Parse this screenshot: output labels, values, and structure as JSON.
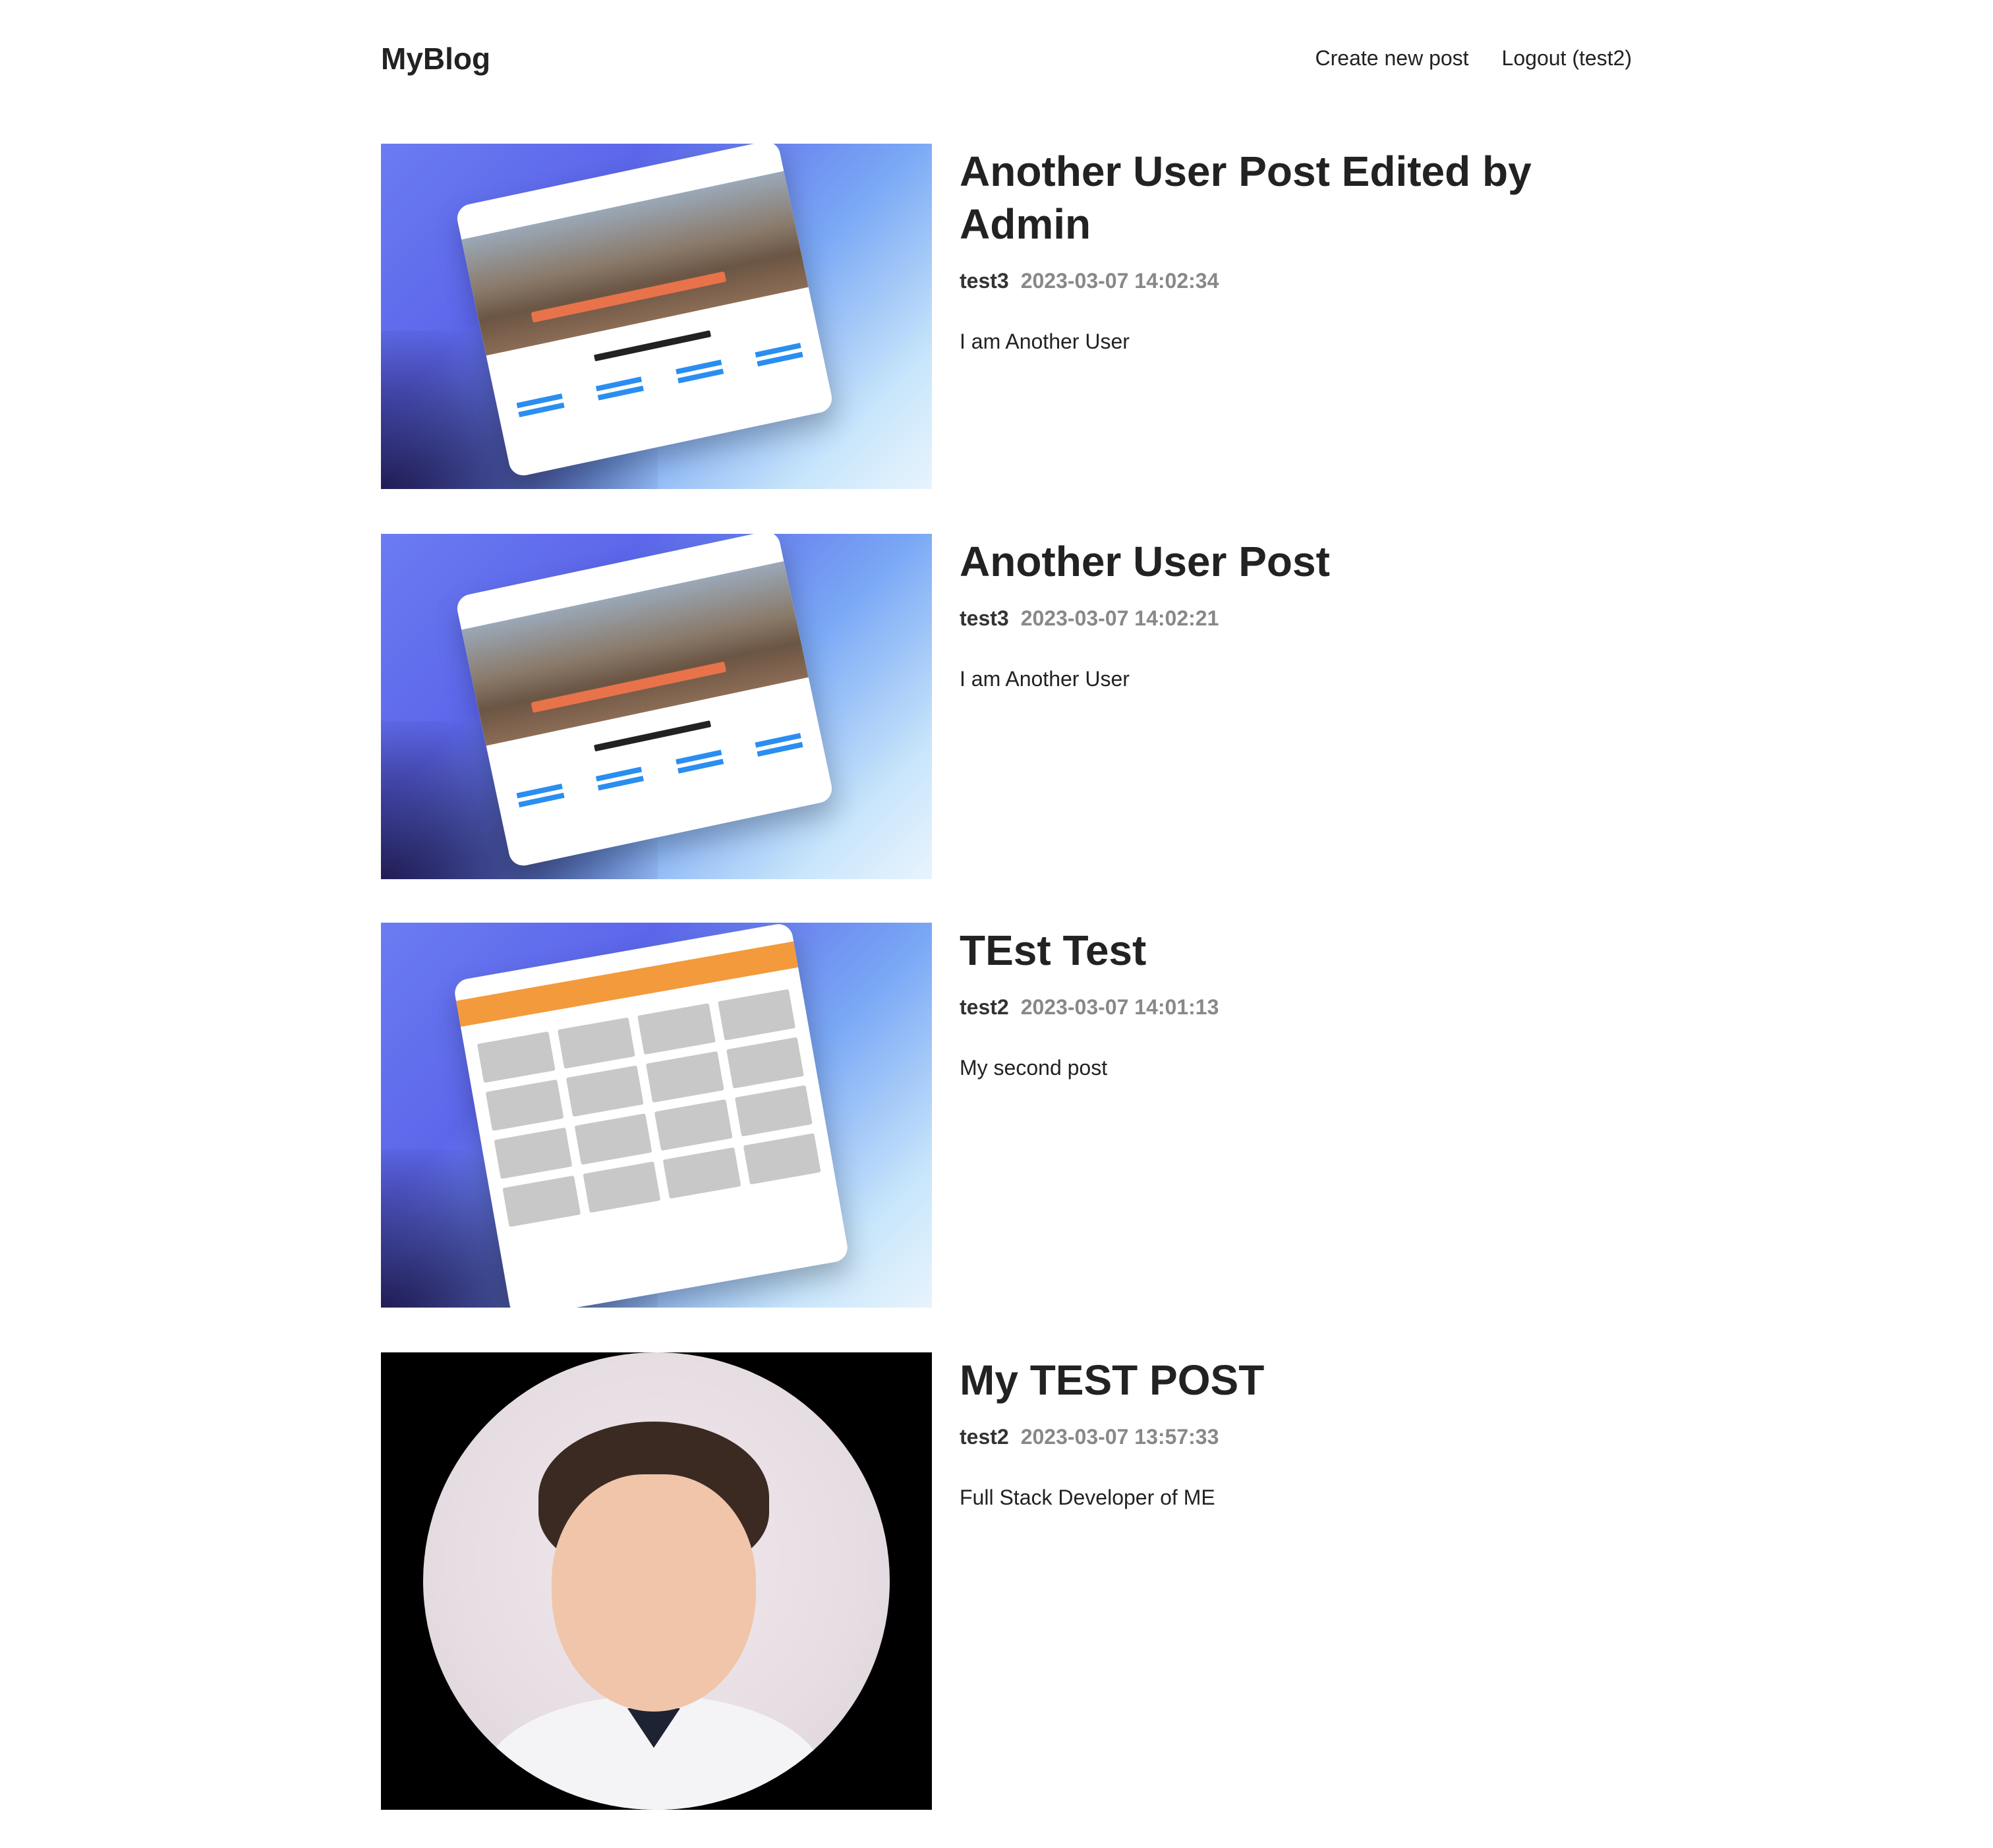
{
  "header": {
    "logo": "MyBlog",
    "nav": {
      "create_label": "Create new post",
      "logout_label": "Logout (test2)"
    }
  },
  "posts": [
    {
      "title": "Another User Post Edited by Admin",
      "author": "test3",
      "time": "2023-03-07 14:02:34",
      "summary": "I am Another User",
      "image_icon": "website-screenshot-image"
    },
    {
      "title": "Another User Post",
      "author": "test3",
      "time": "2023-03-07 14:02:21",
      "summary": "I am Another User",
      "image_icon": "website-screenshot-image"
    },
    {
      "title": "TEst Test",
      "author": "test2",
      "time": "2023-03-07 14:01:13",
      "summary": "My second post",
      "image_icon": "website-screenshot-image"
    },
    {
      "title": "My TEST POST",
      "author": "test2",
      "time": "2023-03-07 13:57:33",
      "summary": "Full Stack Developer of ME",
      "image_icon": "profile-photo-image"
    }
  ]
}
